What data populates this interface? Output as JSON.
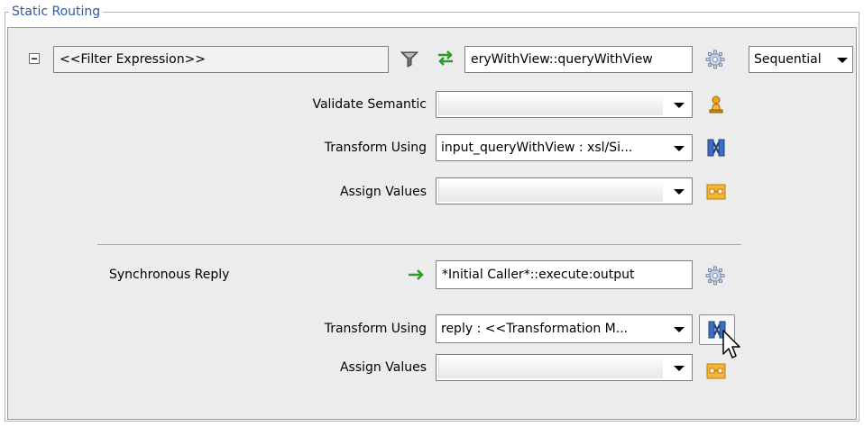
{
  "group": {
    "title": "Static Routing"
  },
  "rule": {
    "filter_expression": "<<Filter Expression>>",
    "target_operation": "eryWithView::queryWithView",
    "execution_mode": "Sequential",
    "validate_semantic": {
      "label": "Validate Semantic",
      "value": ""
    },
    "transform": {
      "label": "Transform Using",
      "value": "input_queryWithView : xsl/Si..."
    },
    "assign": {
      "label": "Assign Values",
      "value": ""
    }
  },
  "reply": {
    "label": "Synchronous Reply",
    "target": "*Initial Caller*::execute:output",
    "transform": {
      "label": "Transform Using",
      "value": "reply : <<Transformation M..."
    },
    "assign": {
      "label": "Assign Values",
      "value": ""
    }
  },
  "icons": {
    "collapse": "minus-box-icon",
    "filter": "funnel-icon",
    "routing": "swap-arrows-icon",
    "service": "gear-icon",
    "validate": "person-icon",
    "transform": "transform-mapper-icon",
    "assign": "assign-values-icon",
    "reply_arrow": "right-arrow-icon",
    "cursor": "mouse-pointer-icon"
  }
}
